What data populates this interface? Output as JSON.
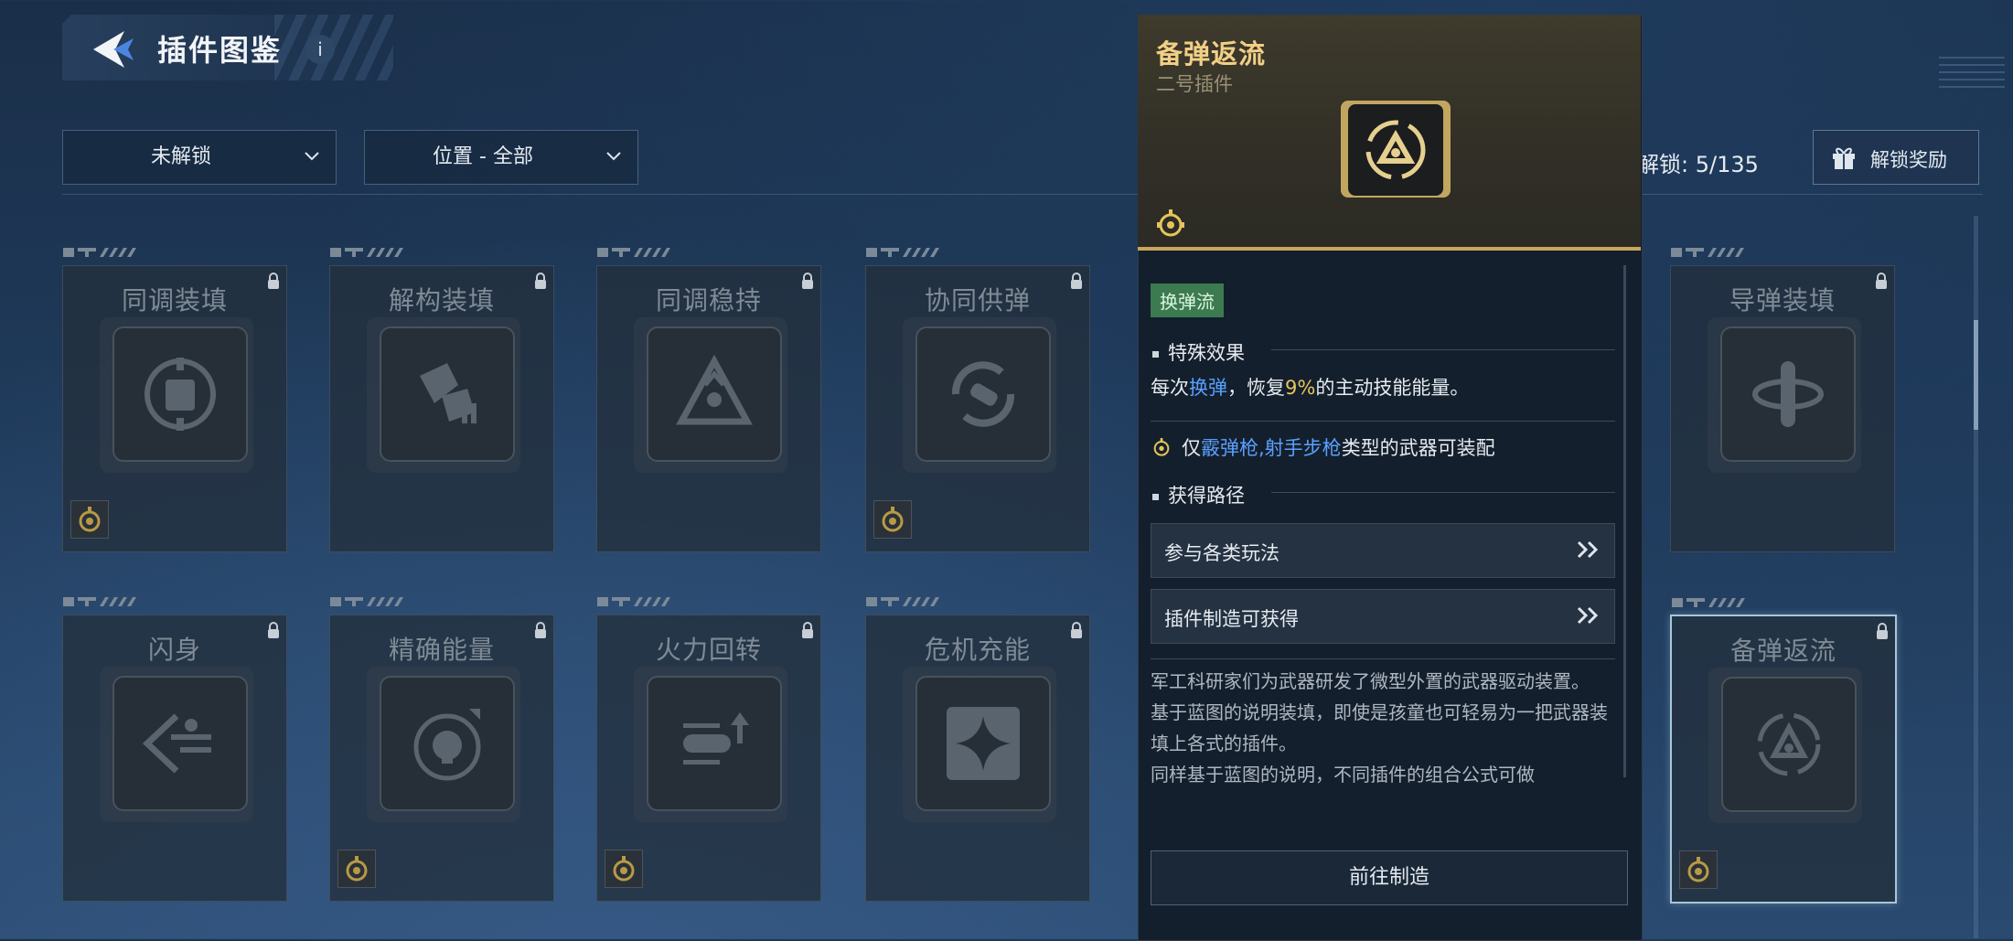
{
  "header": {
    "title": "插件图鉴",
    "info_label": "i"
  },
  "filters": [
    {
      "label": "未解锁"
    },
    {
      "label": "位置 - 全部"
    }
  ],
  "unlock_progress": {
    "text": "解锁: 5/135",
    "unlocked": 5,
    "total": 135
  },
  "reward_button": {
    "label": "解锁奖励"
  },
  "cards": [
    {
      "name": "同调装填",
      "icon": "fist-target-icon",
      "has_type_badge": true
    },
    {
      "name": "解构装填",
      "icon": "broken-ammo-icon",
      "has_type_badge": false
    },
    {
      "name": "同调稳持",
      "icon": "triangle-cycle-icon",
      "has_type_badge": false
    },
    {
      "name": "协同供弹",
      "icon": "bullet-cycle-icon",
      "has_type_badge": true
    },
    {
      "name": "导弹装填",
      "icon": "missile-icon",
      "has_type_badge": false
    },
    {
      "name": "闪身",
      "icon": "dash-runner-icon",
      "has_type_badge": false
    },
    {
      "name": "精确能量",
      "icon": "skull-target-icon",
      "has_type_badge": true
    },
    {
      "name": "火力回转",
      "icon": "bullet-up-icon",
      "has_type_badge": true
    },
    {
      "name": "危机充能",
      "icon": "star-diamond-icon",
      "has_type_badge": false
    },
    {
      "name": "备弹返流",
      "icon": "triangle-return-icon",
      "has_type_badge": true,
      "selected": true
    }
  ],
  "detail": {
    "title": "备弹返流",
    "subtitle": "二号插件",
    "tag": "换弹流",
    "effect_heading": "特殊效果",
    "effect_pre": "每次",
    "effect_kw": "换弹",
    "effect_mid": "，恢复",
    "effect_pct": "9%",
    "effect_post": "的主动技能能量。",
    "cond_pre": "仅",
    "cond_kw": "霰弹枪,射手步枪",
    "cond_post": "类型的武器可装配",
    "route_heading": "获得路径",
    "routes": [
      "参与各类玩法",
      "插件制造可获得"
    ],
    "description": "军工科研家们为武器研发了微型外置的武器驱动装置。\n基于蓝图的说明装填，即使是孩童也可轻易为一把武器装填上各式的插件。\n同样基于蓝图的说明，不同插件的组合公式可做",
    "go_button": "前往制造"
  },
  "colors": {
    "gold": "#f1cf86",
    "accent_blue": "#5aa0ff",
    "tag_green": "#3c7a4f"
  }
}
